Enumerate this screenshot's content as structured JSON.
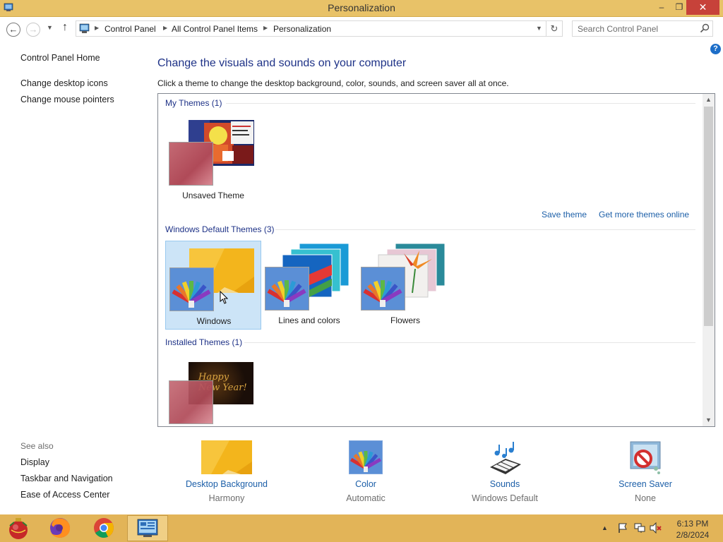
{
  "window": {
    "title": "Personalization",
    "controls": {
      "minimize": "‒",
      "maximize": "❐",
      "close": "✕"
    }
  },
  "nav": {
    "back_icon": "back-arrow-icon",
    "forward_icon": "forward-arrow-icon",
    "breadcrumbs": [
      "Control Panel",
      "All Control Panel Items",
      "Personalization"
    ],
    "search_placeholder": "Search Control Panel"
  },
  "sidebar": {
    "home": "Control Panel Home",
    "links": [
      "Change desktop icons",
      "Change mouse pointers"
    ],
    "see_also_label": "See also",
    "see_also": [
      "Display",
      "Taskbar and Navigation",
      "Ease of Access Center"
    ]
  },
  "main": {
    "title": "Change the visuals and sounds on your computer",
    "description": "Click a theme to change the desktop background, color, sounds, and screen saver all at once.",
    "sections": {
      "my_themes": "My Themes (1)",
      "windows_default": "Windows Default Themes (3)",
      "installed": "Installed Themes (1)"
    },
    "my_themes": [
      {
        "name": "Unsaved Theme"
      }
    ],
    "links": {
      "save": "Save theme",
      "more": "Get more themes online"
    },
    "default_themes": [
      {
        "name": "Windows",
        "selected": true
      },
      {
        "name": "Lines and colors",
        "selected": false
      },
      {
        "name": "Flowers",
        "selected": false
      }
    ],
    "installed_theme_text": "Happy New Year!"
  },
  "bottom": [
    {
      "label": "Desktop Background",
      "value": "Harmony"
    },
    {
      "label": "Color",
      "value": "Automatic"
    },
    {
      "label": "Sounds",
      "value": "Windows Default"
    },
    {
      "label": "Screen Saver",
      "value": "None"
    }
  ],
  "taskbar": {
    "time": "6:13 PM",
    "date": "2/8/2024",
    "apps": [
      "firefox",
      "chrome",
      "control-panel"
    ]
  },
  "colors": {
    "titlebar": "#e8c268",
    "taskbar": "#e2b458",
    "heading_blue": "#1e3287",
    "link_blue": "#1c5fa8",
    "selection": "#cce4f7"
  }
}
